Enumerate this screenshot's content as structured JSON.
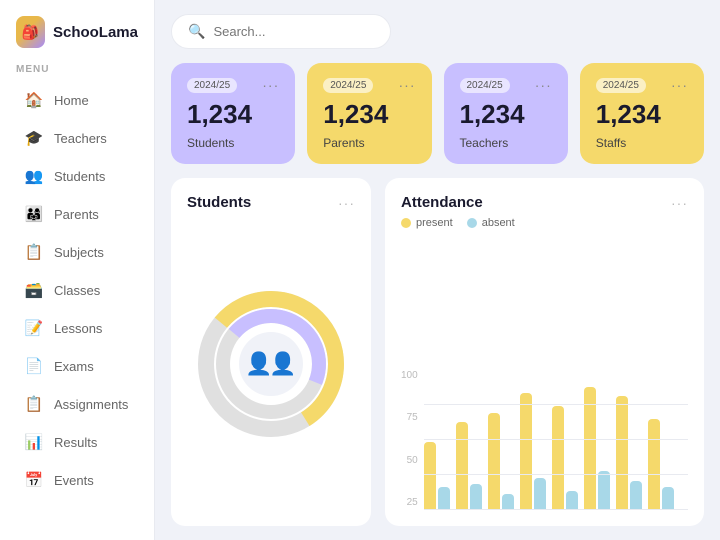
{
  "app": {
    "name": "SchooLama"
  },
  "sidebar": {
    "menu_label": "MENU",
    "items": [
      {
        "id": "home",
        "label": "Home",
        "icon": "🏠",
        "active": false
      },
      {
        "id": "teachers",
        "label": "Teachers",
        "icon": "🎓",
        "active": false
      },
      {
        "id": "students",
        "label": "Students",
        "icon": "👥",
        "active": false
      },
      {
        "id": "parents",
        "label": "Parents",
        "icon": "👨‍👩‍👧",
        "active": false
      },
      {
        "id": "subjects",
        "label": "Subjects",
        "icon": "📋",
        "active": false
      },
      {
        "id": "classes",
        "label": "Classes",
        "icon": "🗃️",
        "active": false
      },
      {
        "id": "lessons",
        "label": "Lessons",
        "icon": "📝",
        "active": false
      },
      {
        "id": "exams",
        "label": "Exams",
        "icon": "📄",
        "active": false
      },
      {
        "id": "assignments",
        "label": "Assignments",
        "icon": "📋",
        "active": false
      },
      {
        "id": "results",
        "label": "Results",
        "icon": "📊",
        "active": false
      },
      {
        "id": "events",
        "label": "Events",
        "icon": "📅",
        "active": false
      }
    ]
  },
  "search": {
    "placeholder": "Search..."
  },
  "stats": [
    {
      "id": "students",
      "year": "2024/25",
      "number": "1,234",
      "label": "Students",
      "color": "purple"
    },
    {
      "id": "parents",
      "year": "2024/25",
      "number": "1,234",
      "label": "Parents",
      "color": "yellow"
    },
    {
      "id": "teachers",
      "year": "2024/25",
      "number": "1,234",
      "label": "Teachers",
      "color": "purple"
    },
    {
      "id": "staffs",
      "year": "2024/25",
      "number": "1,234",
      "label": "Staffs",
      "color": "yellow"
    }
  ],
  "students_panel": {
    "title": "Students",
    "donut": {
      "male_pct": 55,
      "female_pct": 45,
      "colors": {
        "outer": "#f5d96b",
        "inner": "#c8bfff",
        "bg": "#e8e8e8"
      }
    }
  },
  "attendance_panel": {
    "title": "Attendance",
    "legend": {
      "present": "present",
      "absent": "absent"
    },
    "y_labels": [
      "100",
      "75",
      "50",
      "25"
    ],
    "bars": [
      {
        "present": 52,
        "absent": 18
      },
      {
        "present": 68,
        "absent": 20
      },
      {
        "present": 75,
        "absent": 12
      },
      {
        "present": 90,
        "absent": 25
      },
      {
        "present": 80,
        "absent": 15
      },
      {
        "present": 95,
        "absent": 30
      },
      {
        "present": 88,
        "absent": 22
      },
      {
        "present": 70,
        "absent": 18
      }
    ]
  }
}
